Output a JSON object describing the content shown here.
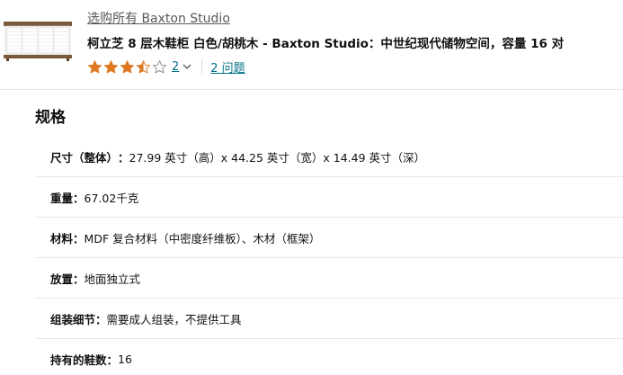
{
  "product": {
    "brand_link": "选购所有 Baxton Studio",
    "title": "柯立芝 8 层木鞋柜 白色/胡桃木 - Baxton Studio：中世纪现代储物空间，容量 16 对",
    "rating": 3.5,
    "rating_max": 5,
    "rating_count": "2",
    "questions_link": "2 问题",
    "star_color": "#de7921",
    "link_color": "#007185"
  },
  "specs": {
    "heading": "规格",
    "rows": [
      {
        "label": "尺寸（整体）",
        "value": "27.99 英寸（高）x 44.25 英寸（宽）x 14.49 英寸（深）"
      },
      {
        "label": "重量",
        "value": "67.02千克"
      },
      {
        "label": "材料",
        "value": "MDF 复合材料（中密度纤维板）、木材（框架）"
      },
      {
        "label": "放置",
        "value": "地面独立式"
      },
      {
        "label": "组装细节",
        "value": "需要成人组装，不提供工具"
      },
      {
        "label": "持有的鞋数",
        "value": "16"
      }
    ]
  }
}
